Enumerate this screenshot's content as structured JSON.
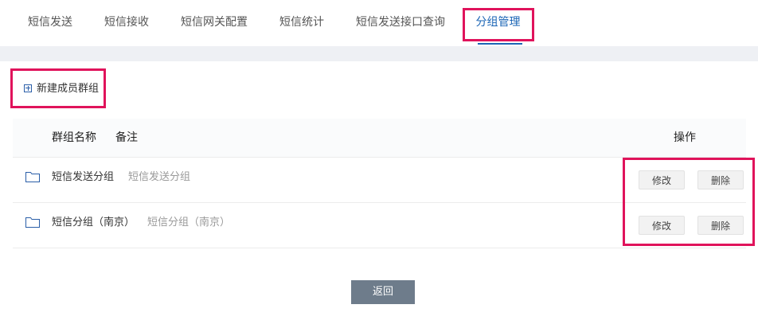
{
  "tabs": [
    {
      "label": "短信发送"
    },
    {
      "label": "短信接收"
    },
    {
      "label": "短信网关配置"
    },
    {
      "label": "短信统计"
    },
    {
      "label": "短信发送接口查询"
    },
    {
      "label": "分组管理",
      "active": true
    }
  ],
  "new_group": {
    "label": "新建成员群组",
    "icon": "plus-square-icon"
  },
  "table": {
    "headers": {
      "name": "群组名称",
      "note": "备注",
      "actions": "操作"
    },
    "rows": [
      {
        "name": "短信发送分组",
        "note": "短信发送分组",
        "icon": "folder-icon",
        "edit_label": "修改",
        "delete_label": "删除"
      },
      {
        "name": "短信分组（南京）",
        "note": "短信分组（南京）",
        "icon": "folder-icon",
        "edit_label": "修改",
        "delete_label": "删除"
      }
    ]
  },
  "back_label": "返回",
  "colors": {
    "accent": "#1a64b5",
    "highlight": "#e0135b",
    "back_button": "#6e7c8b"
  }
}
